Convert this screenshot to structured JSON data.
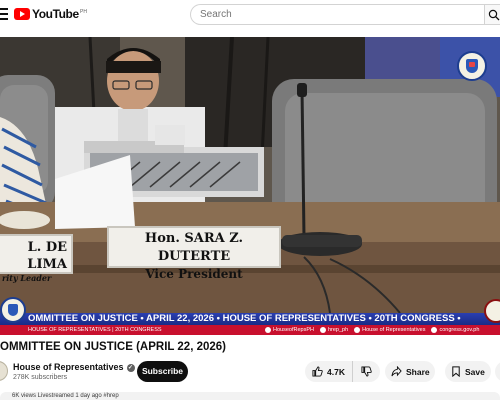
{
  "masthead": {
    "logo_text": "YouTube",
    "country_code": "PH",
    "search_placeholder": "Search"
  },
  "video": {
    "nameplate_left": {
      "line1": "L. DE LIMA",
      "line2": "rity Leader"
    },
    "nameplate_center": {
      "line1": "Hon. SARA Z. DUTERTE",
      "line2": "Vice President"
    },
    "ticker_text": "OMMITTEE ON JUSTICE • APRIL 22, 2026 • HOUSE OF REPRESENTATIVES • 20TH CONGRESS •",
    "subticker_left": "HOUSE OF REPRESENTATIVES | 20TH CONGRESS",
    "subticker_social": [
      "HouseofRepsPH",
      "hrep_ph",
      "House of Representatives",
      "congress.gov.ph"
    ]
  },
  "title": "OMMITTEE ON JUSTICE (APRIL 22, 2026)",
  "channel": {
    "name": "House of Representatives",
    "verified_mark": "✓",
    "subscribers": "278K subscribers",
    "subscribe_label": "Subscribe"
  },
  "actions": {
    "like_count": "4.7K",
    "share_label": "Share",
    "save_label": "Save"
  },
  "description_preview": "6K views  Livestreamed 1 day ago  #hrep"
}
